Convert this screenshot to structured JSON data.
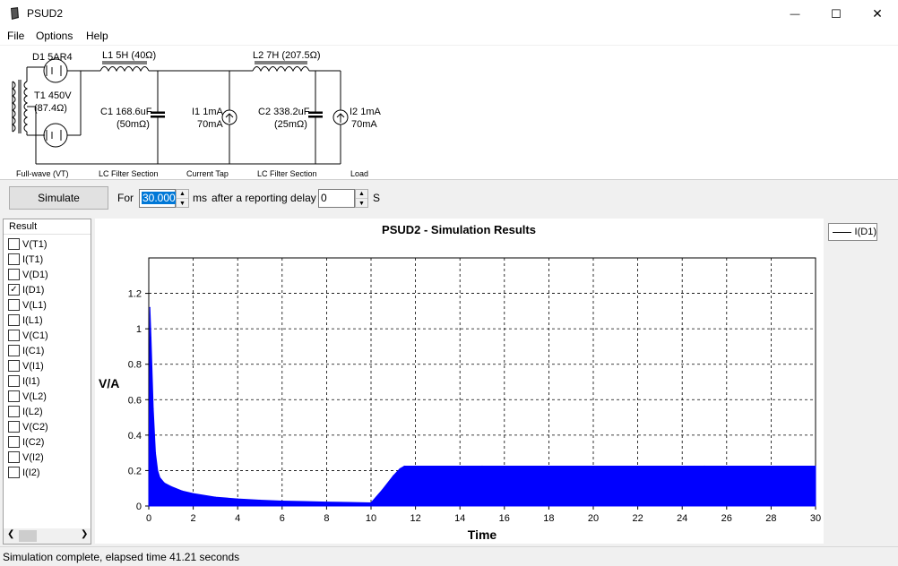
{
  "window": {
    "title": "PSUD2",
    "minimize_glyph": "—",
    "maximize_glyph": "☐",
    "close_glyph": "✕"
  },
  "menu": [
    "File",
    "Options",
    "Help"
  ],
  "schematic": {
    "d1_label": "D1 5AR4",
    "t1_label": "T1 450V",
    "t1_res": "(87.4Ω)",
    "l1_label": "L1 5H (40Ω)",
    "l2_label": "L2 7H (207.5Ω)",
    "c1_label": "C1 168.6uF",
    "c1_res": "(50mΩ)",
    "i1_label": "I1 1mA",
    "i1_val": "70mA",
    "c2_label": "C2 338.2uF",
    "c2_res": "(25mΩ)",
    "i2_label": "I2 1mA",
    "i2_val": "70mA",
    "sections": [
      "Full-wave (VT)",
      "LC Filter Section",
      "Current Tap",
      "LC Filter Section",
      "Load"
    ]
  },
  "toolbar": {
    "simulate_label": "Simulate",
    "for_label": "For",
    "duration_value": "30.000",
    "ms_label": "ms",
    "delay_label": "after a reporting delay of",
    "delay_value": "0",
    "s_label": "S"
  },
  "results": {
    "header": "Result",
    "items": [
      {
        "label": "V(T1)",
        "checked": false
      },
      {
        "label": "I(T1)",
        "checked": false
      },
      {
        "label": "V(D1)",
        "checked": false
      },
      {
        "label": "I(D1)",
        "checked": true
      },
      {
        "label": "V(L1)",
        "checked": false
      },
      {
        "label": "I(L1)",
        "checked": false
      },
      {
        "label": "V(C1)",
        "checked": false
      },
      {
        "label": "I(C1)",
        "checked": false
      },
      {
        "label": "V(I1)",
        "checked": false
      },
      {
        "label": "I(I1)",
        "checked": false
      },
      {
        "label": "V(L2)",
        "checked": false
      },
      {
        "label": "I(L2)",
        "checked": false
      },
      {
        "label": "V(C2)",
        "checked": false
      },
      {
        "label": "I(C2)",
        "checked": false
      },
      {
        "label": "V(I2)",
        "checked": false
      },
      {
        "label": "I(I2)",
        "checked": false
      }
    ]
  },
  "chart_data": {
    "type": "area",
    "title": "PSUD2 - Simulation Results",
    "xlabel": "Time",
    "ylabel": "V/A",
    "xlim": [
      0,
      30
    ],
    "ylim": [
      0,
      1.4
    ],
    "xticks": [
      0,
      2,
      4,
      6,
      8,
      10,
      12,
      14,
      16,
      18,
      20,
      22,
      24,
      26,
      28,
      30
    ],
    "yticks": [
      0,
      0.2,
      0.4,
      0.6,
      0.8,
      1,
      1.2
    ],
    "grid": true,
    "legend_position": "top-right",
    "series": [
      {
        "name": "I(D1)",
        "color": "#0000ff",
        "x": [
          0,
          0.05,
          0.1,
          0.2,
          0.3,
          0.4,
          0.5,
          0.7,
          1,
          1.5,
          2,
          3,
          4,
          5,
          6,
          7,
          8,
          9,
          10,
          10.5,
          11,
          11.3,
          11.5,
          12,
          15,
          20,
          25,
          30
        ],
        "y": [
          0,
          1.12,
          0.95,
          0.55,
          0.3,
          0.2,
          0.16,
          0.13,
          0.11,
          0.085,
          0.07,
          0.05,
          0.04,
          0.033,
          0.028,
          0.025,
          0.022,
          0.02,
          0.018,
          0.09,
          0.17,
          0.21,
          0.225,
          0.225,
          0.225,
          0.225,
          0.225,
          0.225
        ]
      }
    ]
  },
  "status": "Simulation complete, elapsed time 41.21 seconds"
}
